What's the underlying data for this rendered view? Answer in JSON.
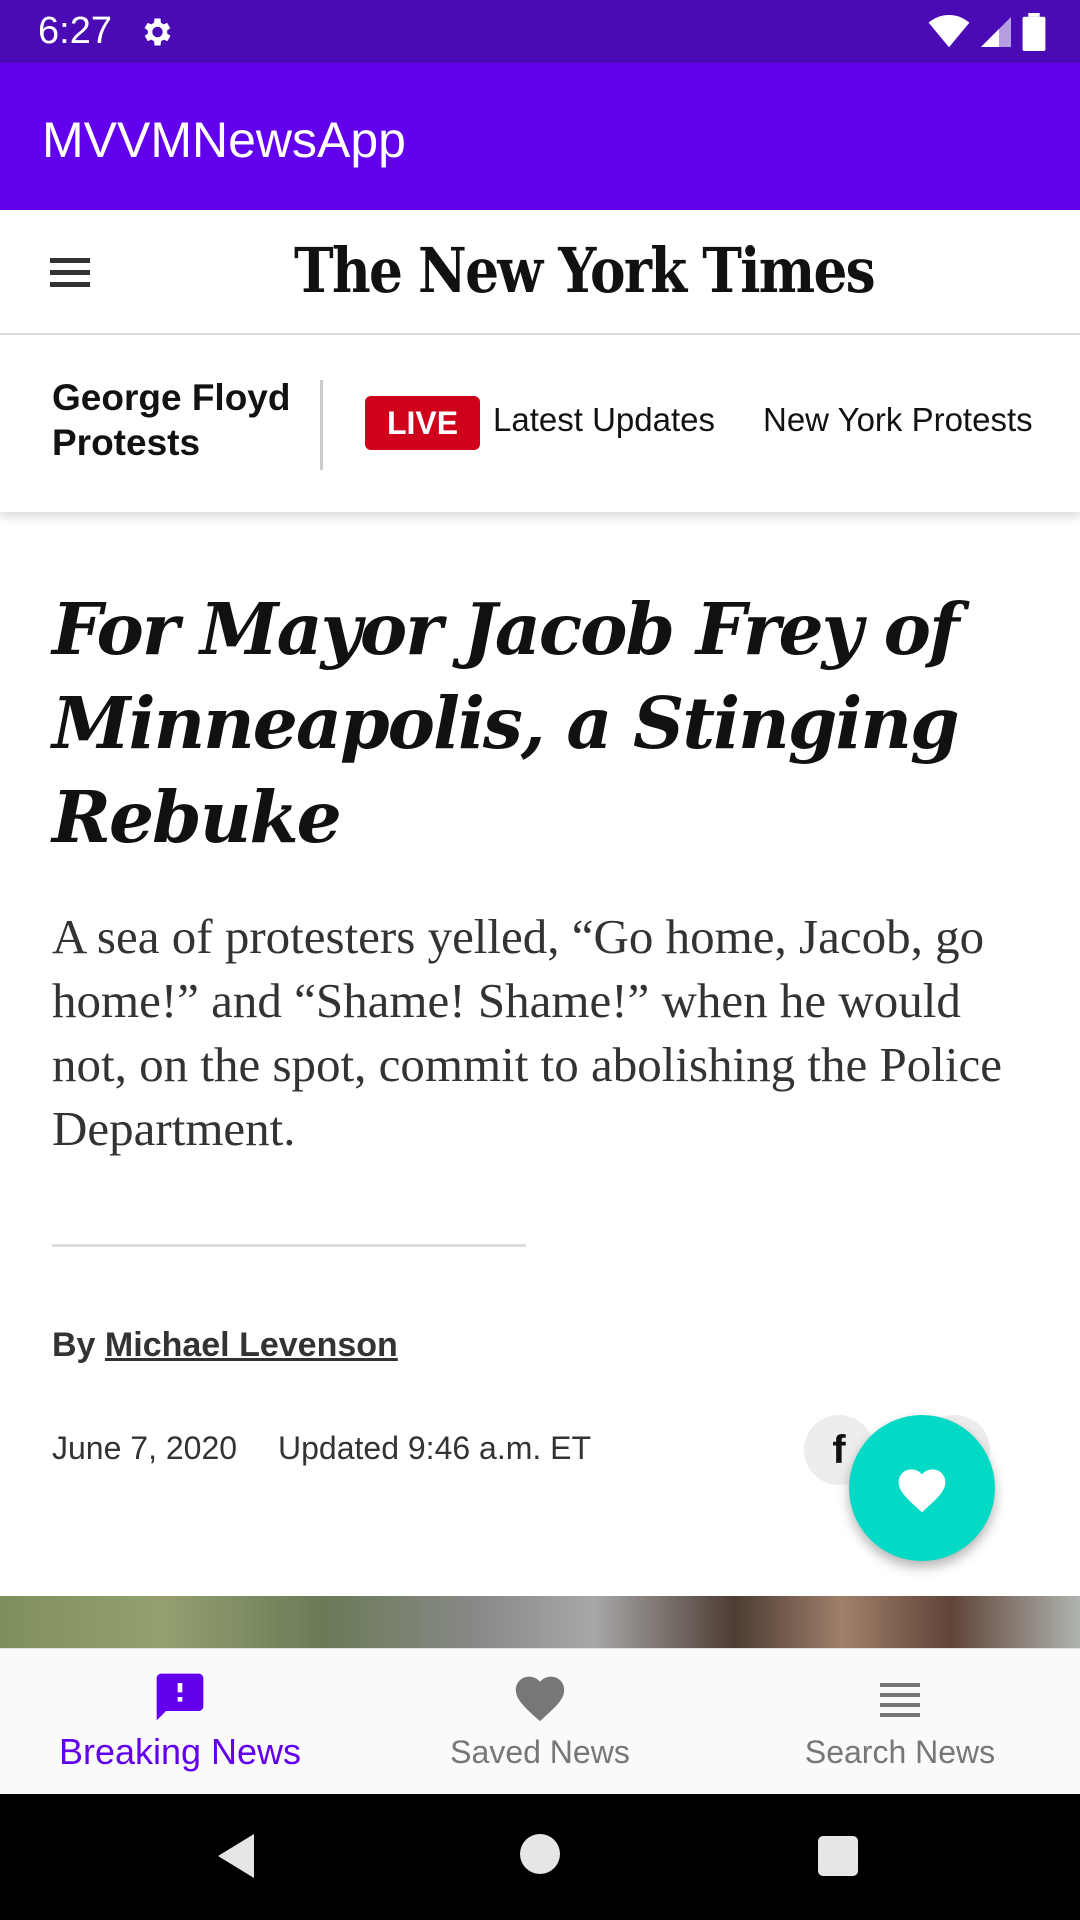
{
  "status_bar": {
    "time": "6:27",
    "icons": [
      "settings-gear-icon",
      "wifi-icon",
      "signal-icon",
      "battery-icon"
    ]
  },
  "app_bar": {
    "title": "MVVMNewsApp"
  },
  "nyt_header": {
    "logo_text": "The New York Times",
    "menu_icon": "hamburger-menu-icon"
  },
  "story_nav": {
    "topic": "George Floyd Protests",
    "live_badge": "LIVE",
    "latest_updates": "Latest Updates",
    "new_york_protests": "New York Protests"
  },
  "article": {
    "headline": "For Mayor Jacob Frey of Minneapolis, a Stinging Rebuke",
    "summary": "A sea of protesters yelled, “Go home, Jacob, go home!” and “Shame! Shame!” when he would not, on the spot, commit to abolishing the Police Department.",
    "byline_prefix": "By",
    "author": "Michael Levenson",
    "date": "June 7, 2020",
    "updated": "Updated 9:46 a.m. ET",
    "share_facebook": "f"
  },
  "fab": {
    "icon": "heart-icon",
    "color": "#03dac5"
  },
  "bottom_nav": {
    "items": [
      {
        "label": "Breaking News",
        "icon": "alert-message-icon",
        "active": true
      },
      {
        "label": "Saved News",
        "icon": "heart-icon",
        "active": false
      },
      {
        "label": "Search News",
        "icon": "list-icon",
        "active": false
      }
    ]
  },
  "colors": {
    "status_bar": "#4a0bb4",
    "app_bar": "#6200ee",
    "live_red": "#d0021b",
    "accent": "#03dac5",
    "active_nav": "#6200ee"
  }
}
